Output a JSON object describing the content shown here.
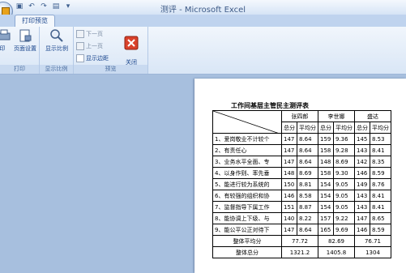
{
  "window": {
    "title": "测评 - Microsoft Excel"
  },
  "tabs": [
    {
      "label": "打印预览"
    }
  ],
  "ribbon": {
    "groups": [
      {
        "label": "打印",
        "buttons": [
          {
            "label": "印"
          },
          {
            "label": "页面设置"
          }
        ]
      },
      {
        "label": "显示比例",
        "buttons": [
          {
            "label": "显示比例"
          }
        ]
      },
      {
        "label": "预览",
        "small": [
          {
            "label": "下一页"
          },
          {
            "label": "上一页"
          },
          {
            "label": "显示边距"
          }
        ],
        "buttons": [
          {
            "label": "关闭\n打印预览"
          }
        ]
      }
    ]
  },
  "sheet": {
    "title": "工作间基层主管民主测评表",
    "people": [
      "张四郎",
      "李世娜",
      "盛达"
    ],
    "subheaders": [
      "总分",
      "平均分"
    ],
    "rows": [
      {
        "label": "1、爱岗敬业不计较个",
        "v": [
          "147",
          "8.64",
          "159",
          "9.36",
          "145",
          "8.53"
        ]
      },
      {
        "label": "2、有责任心",
        "v": [
          "147",
          "8.64",
          "158",
          "9.28",
          "143",
          "8.41"
        ]
      },
      {
        "label": "3、业务水平全面、专",
        "v": [
          "147",
          "8.64",
          "148",
          "8.69",
          "142",
          "8.35"
        ]
      },
      {
        "label": "4、以身作则、率先垂",
        "v": [
          "148",
          "8.69",
          "158",
          "9.30",
          "146",
          "8.59"
        ]
      },
      {
        "label": "5、能进行较为系统的",
        "v": [
          "150",
          "8.81",
          "154",
          "9.05",
          "149",
          "8.76"
        ]
      },
      {
        "label": "6、有较强的组织和协",
        "v": [
          "146",
          "8.58",
          "154",
          "9.05",
          "143",
          "8.41"
        ]
      },
      {
        "label": "7、监督指导下属工作",
        "v": [
          "151",
          "8.87",
          "154",
          "9.05",
          "143",
          "8.41"
        ]
      },
      {
        "label": "8、能协调上下级、与",
        "v": [
          "140",
          "8.22",
          "157",
          "9.22",
          "147",
          "8.65"
        ]
      },
      {
        "label": "9、能公平公正对待下",
        "v": [
          "147",
          "8.64",
          "165",
          "9.69",
          "146",
          "8.59"
        ]
      }
    ],
    "avg_label": "整体平均分",
    "avg": [
      "77.72",
      "82.69",
      "76.71"
    ],
    "total_label": "整体总分",
    "total": [
      "1321.2",
      "1405.8",
      "1304"
    ]
  }
}
